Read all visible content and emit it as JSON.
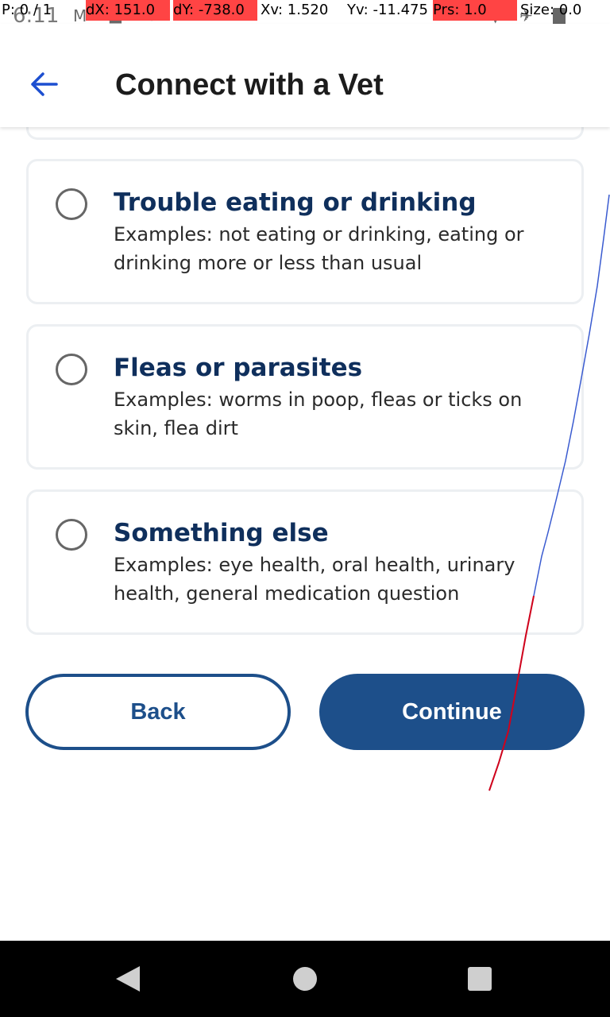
{
  "status_bar": {
    "time": "6:11",
    "debug": {
      "pointer": "P: 0 / 1",
      "dx": "dX: 151.0",
      "dy": "dY: -738.0",
      "xv": "Xv: 1.520",
      "yv": "Yv: -11.475",
      "prs": "Prs: 1.0",
      "size": "Size: 0.0"
    },
    "icons": [
      "gmail-icon",
      "car-icon",
      "location-icon",
      "wifi-icon",
      "airplane-icon",
      "battery-icon"
    ]
  },
  "header": {
    "title": "Connect with a Vet",
    "back_icon": "arrow-left-icon"
  },
  "options": [
    {
      "title": "Trouble eating or drinking",
      "description": "Examples: not eating or drinking, eating or drinking more or less than usual",
      "selected": false
    },
    {
      "title": "Fleas or parasites",
      "description": "Examples: worms in poop, fleas or ticks on skin, flea dirt",
      "selected": false
    },
    {
      "title": "Something else",
      "description": "Examples: eye health, oral health, urinary health, general medication question",
      "selected": false
    }
  ],
  "buttons": {
    "back_label": "Back",
    "continue_label": "Continue"
  },
  "colors": {
    "primary": "#1d4f8a",
    "title_text": "#0f2f5c",
    "card_border": "#eceff2",
    "debug_highlight": "#ff4444",
    "gesture_trace": "#d0021b"
  }
}
